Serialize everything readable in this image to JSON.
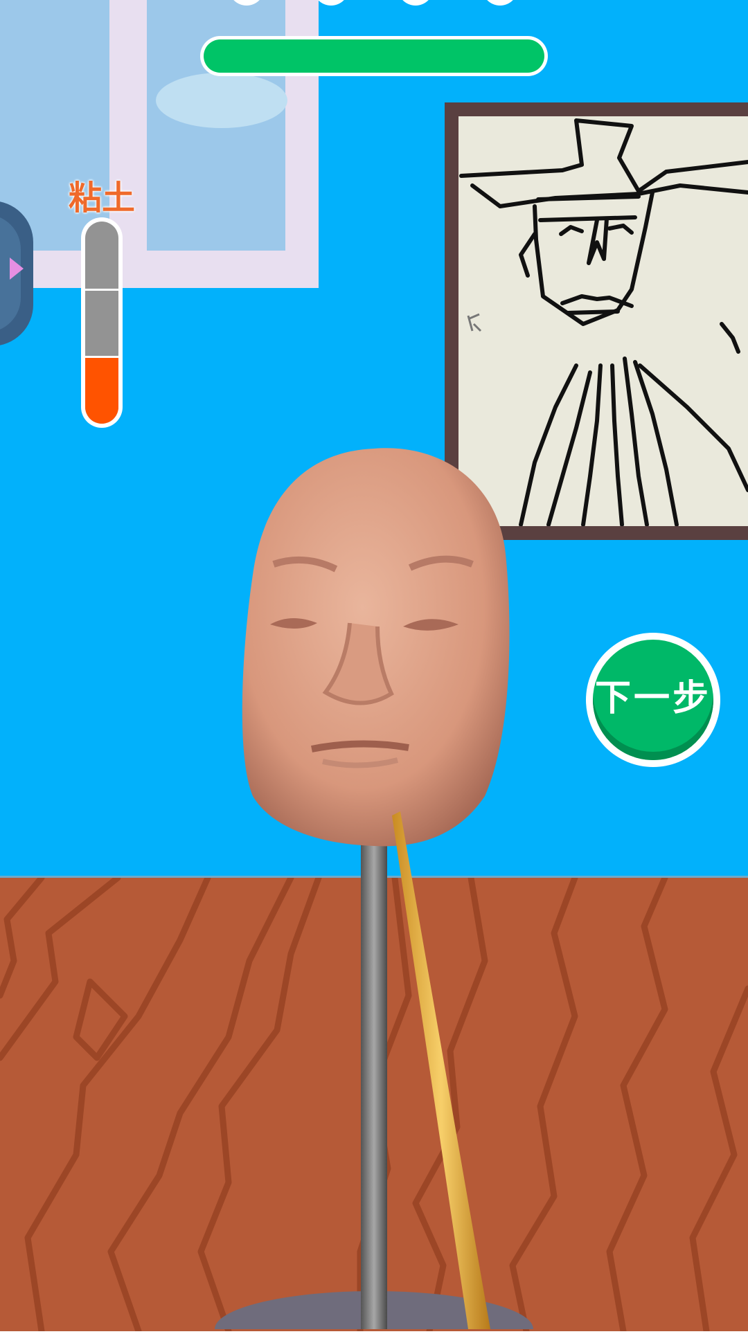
{
  "hud": {
    "level_progress": 1.0,
    "stage_dots": 4,
    "accent_color": "#00c467"
  },
  "clay": {
    "label": "粘土",
    "level": 0.33,
    "segments": 3,
    "fill_color": "#ff5300"
  },
  "next_button": {
    "label": "下一步",
    "color": "#00b868"
  },
  "scene": {
    "wall_color": "#02b1fb",
    "floor_color": "#b65a37",
    "subject": "clay-head-on-stand",
    "tool": "sculpting-stick",
    "reference_picture": "drawing-of-man-with-hat-and-mustache"
  }
}
